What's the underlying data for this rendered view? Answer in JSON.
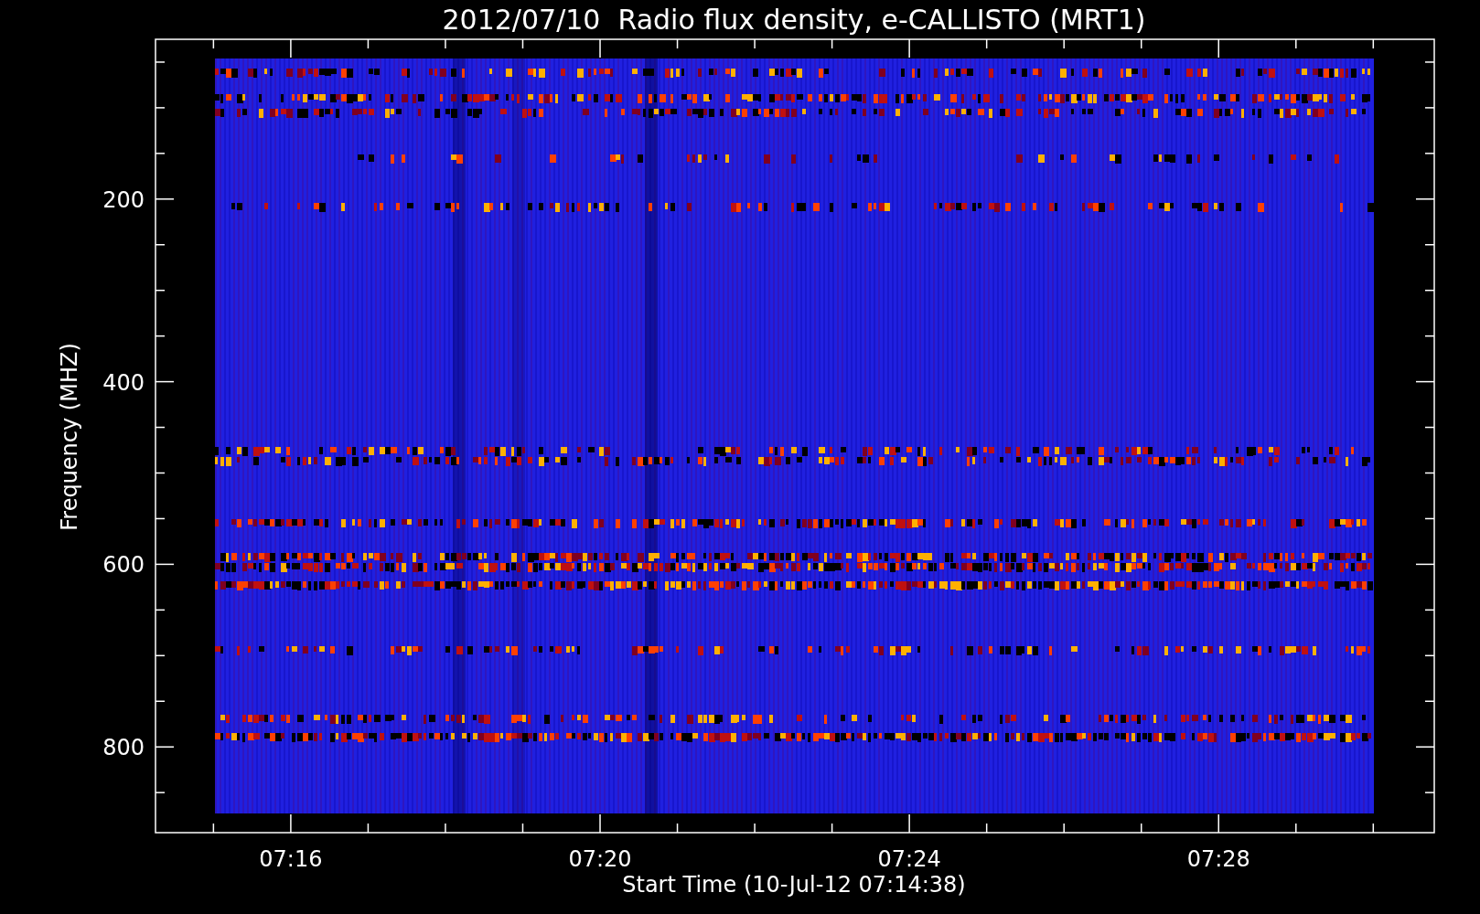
{
  "title": "2012/07/10  Radio flux density, e-CALLISTO (MRT1)",
  "y_axis": {
    "label": "Frequency (MHZ)",
    "ticks": [
      "200",
      "400",
      "600",
      "800"
    ]
  },
  "x_axis": {
    "label": "Start Time (10-Jul-12 07:14:38)",
    "ticks": [
      "07:16",
      "07:20",
      "07:24",
      "07:28"
    ]
  }
}
